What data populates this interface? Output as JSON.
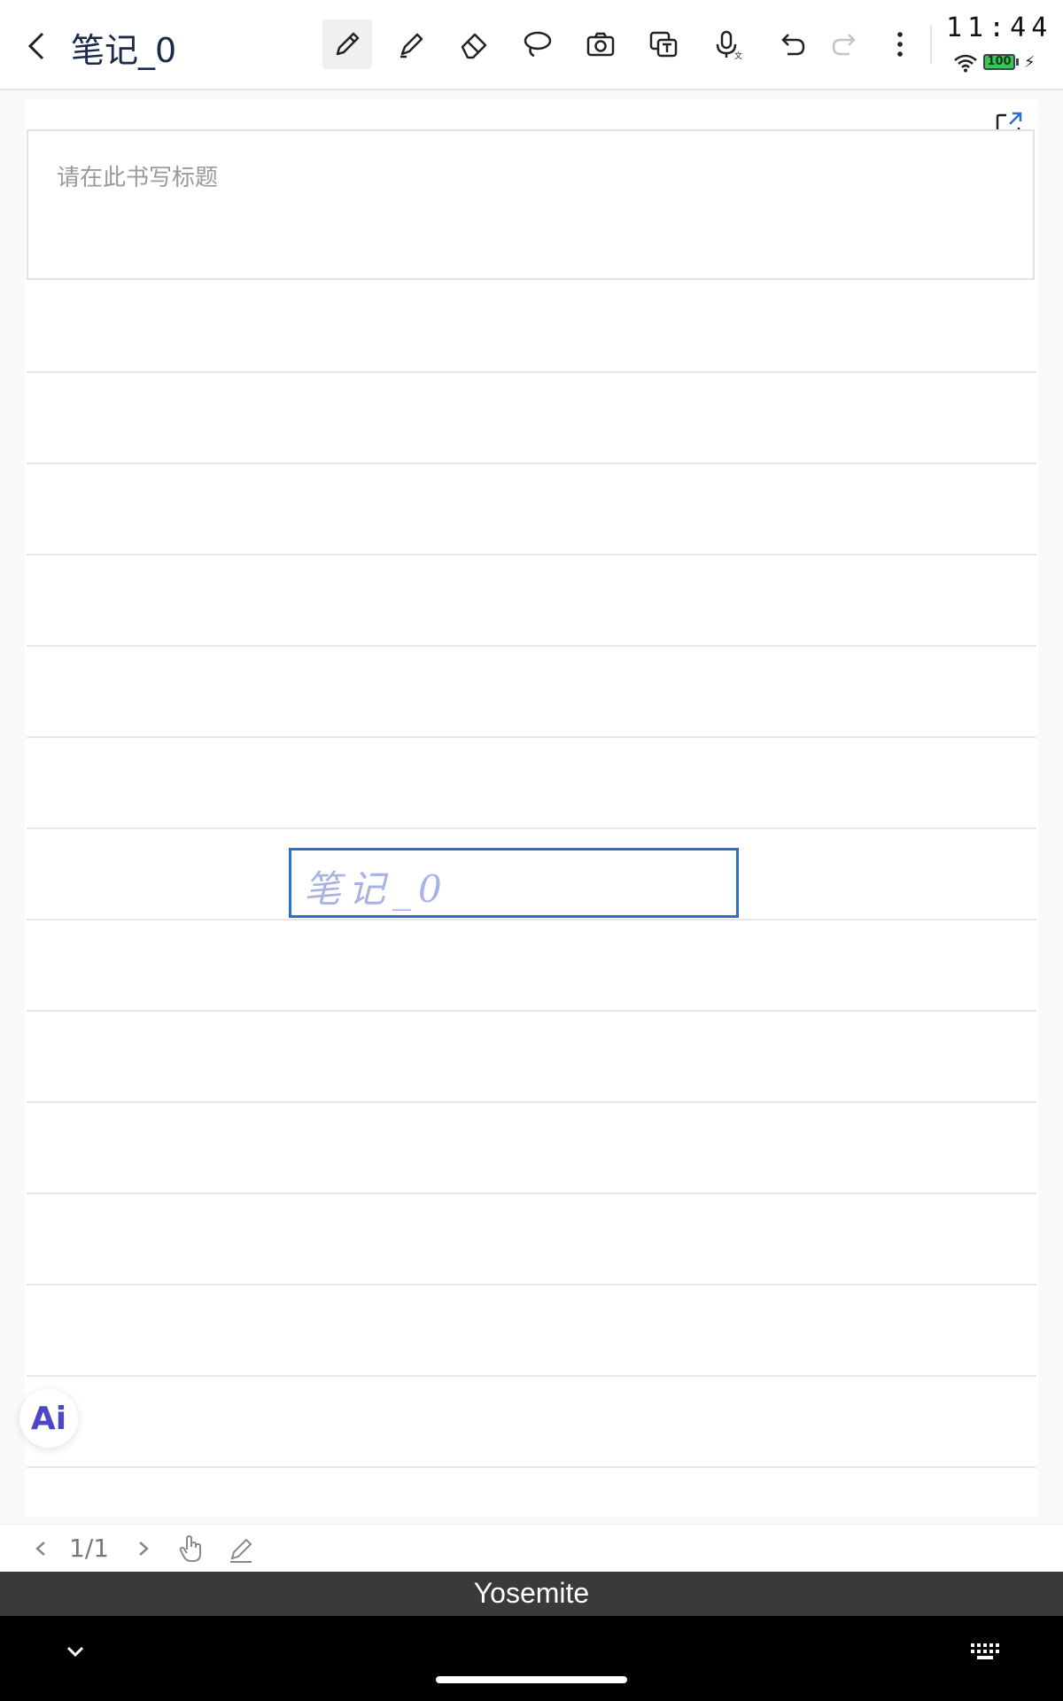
{
  "header": {
    "back_label": "back",
    "title": "笔记_0",
    "tools": [
      {
        "name": "pen",
        "icon": "pen-icon",
        "active": true
      },
      {
        "name": "highlighter",
        "icon": "highlighter-icon",
        "active": false
      },
      {
        "name": "eraser",
        "icon": "eraser-icon",
        "active": false
      },
      {
        "name": "lasso",
        "icon": "lasso-icon",
        "active": false
      },
      {
        "name": "camera",
        "icon": "camera-icon",
        "active": false
      },
      {
        "name": "text-recognition",
        "icon": "ocr-icon",
        "active": false
      },
      {
        "name": "voice",
        "icon": "microphone-icon",
        "active": false
      },
      {
        "name": "undo",
        "icon": "undo-icon",
        "active": false
      },
      {
        "name": "redo",
        "icon": "redo-icon",
        "active": false
      },
      {
        "name": "more",
        "icon": "more-icon",
        "active": false
      }
    ]
  },
  "status": {
    "time": "11:44",
    "battery": "100"
  },
  "page": {
    "title_placeholder": "请在此书写标题",
    "handwriting_text": "笔记_0"
  },
  "ai": {
    "label": "Ai"
  },
  "footer": {
    "page_indicator": "1/1"
  },
  "keyboard": {
    "name": "Yosemite"
  },
  "colors": {
    "accent": "#2a6fcf",
    "handwriting": "#a9b2e6",
    "ai": "#4c46c8"
  }
}
